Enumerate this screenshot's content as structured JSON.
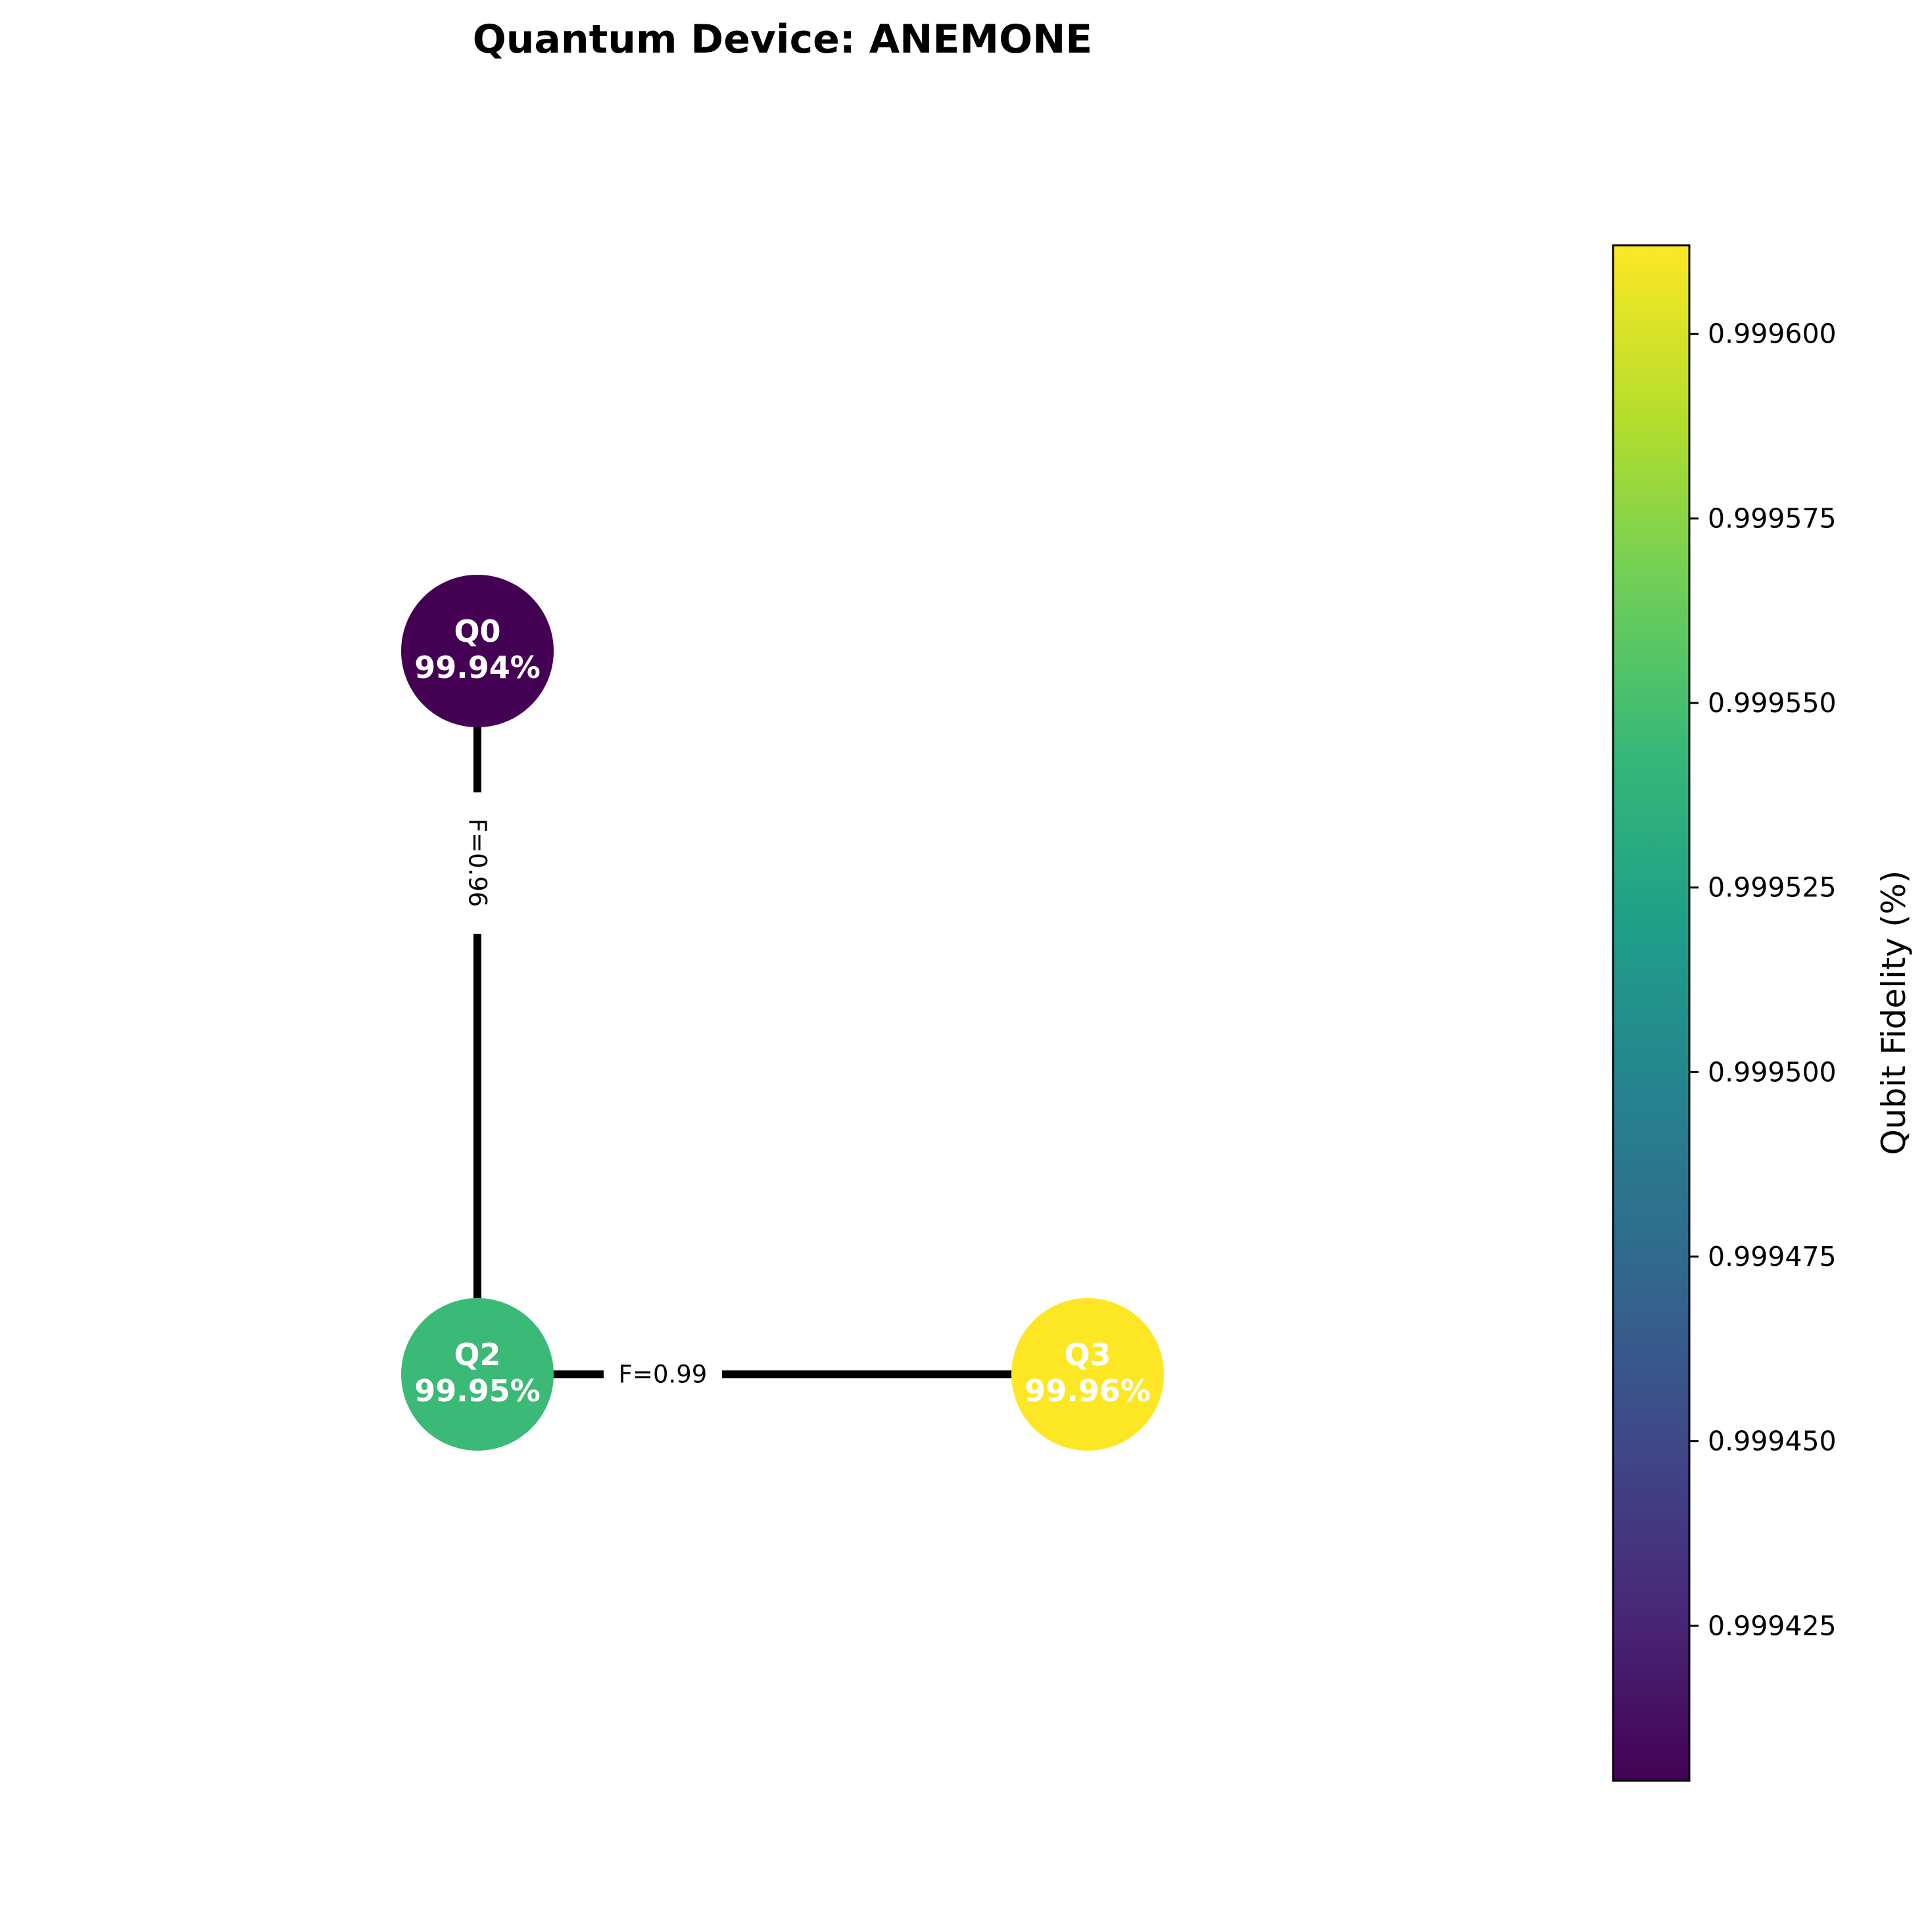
{
  "title": "Quantum Device: ANEMONE",
  "colors": {
    "viridis": [
      "#440154",
      "#482878",
      "#3e4989",
      "#31688e",
      "#26828e",
      "#1f9e89",
      "#35b779",
      "#6ece58",
      "#b5de2b",
      "#fde725"
    ],
    "edge": "#000000",
    "node_text": "#ffffff"
  },
  "colorbar": {
    "label": "Qubit Fidelity (%)",
    "range": [
      0.999404,
      0.999612
    ],
    "ticks": [
      {
        "value": 0.9996,
        "label": "0.999600"
      },
      {
        "value": 0.999575,
        "label": "0.999575"
      },
      {
        "value": 0.99955,
        "label": "0.999550"
      },
      {
        "value": 0.999525,
        "label": "0.999525"
      },
      {
        "value": 0.9995,
        "label": "0.999500"
      },
      {
        "value": 0.999475,
        "label": "0.999475"
      },
      {
        "value": 0.99945,
        "label": "0.999450"
      },
      {
        "value": 0.999425,
        "label": "0.999425"
      }
    ]
  },
  "nodes": [
    {
      "id": "Q0",
      "name": "Q0",
      "fidelity_text": "99.94%",
      "fidelity": 0.999404
    },
    {
      "id": "Q2",
      "name": "Q2",
      "fidelity_text": "99.95%",
      "fidelity": 0.999545
    },
    {
      "id": "Q3",
      "name": "Q3",
      "fidelity_text": "99.96%",
      "fidelity": 0.999612
    }
  ],
  "edges": [
    {
      "source": "Q0",
      "target": "Q2",
      "label": "F=0.96"
    },
    {
      "source": "Q2",
      "target": "Q3",
      "label": "F=0.99"
    }
  ]
}
